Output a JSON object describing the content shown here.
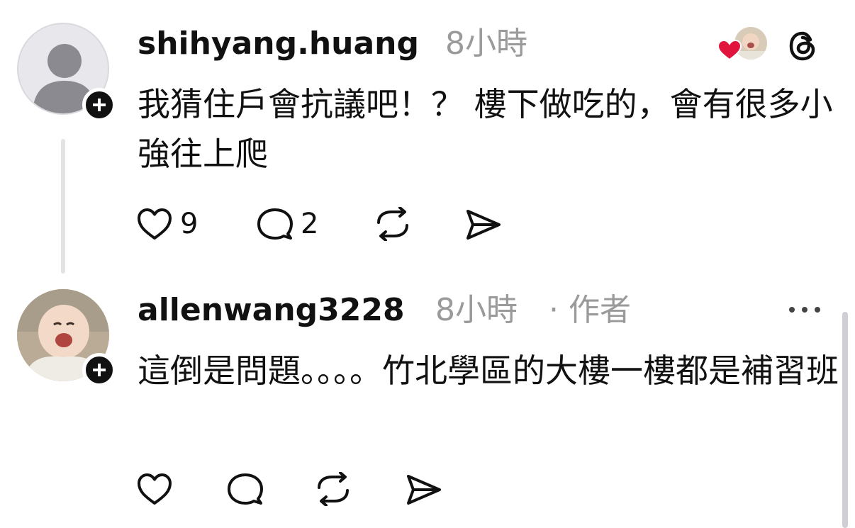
{
  "comments": [
    {
      "username": "shihyang.huang",
      "time": "8小時",
      "author_tag": "",
      "body": "我猜住戶會抗議吧！？ 樓下做吃的，會有很多小強往上爬",
      "likes": "9",
      "replies": "2"
    },
    {
      "username": "allenwang3228",
      "time": "8小時",
      "author_tag": "· 作者",
      "body": "這倒是問題。。。。竹北學區的大樓一樓都是補習班",
      "likes": "",
      "replies": ""
    }
  ],
  "icons": {
    "liked_by": "heart-with-avatar-icon",
    "threads": "threads-logo-icon",
    "more": "more-options-icon",
    "like": "heart-outline-icon",
    "reply": "speech-bubble-icon",
    "repost": "repost-icon",
    "share": "send-icon",
    "follow": "plus-icon"
  },
  "colors": {
    "text": "#111111",
    "meta": "#9a9a9a",
    "liked_heart": "#e0143c",
    "divider": "#e3e3e6"
  }
}
